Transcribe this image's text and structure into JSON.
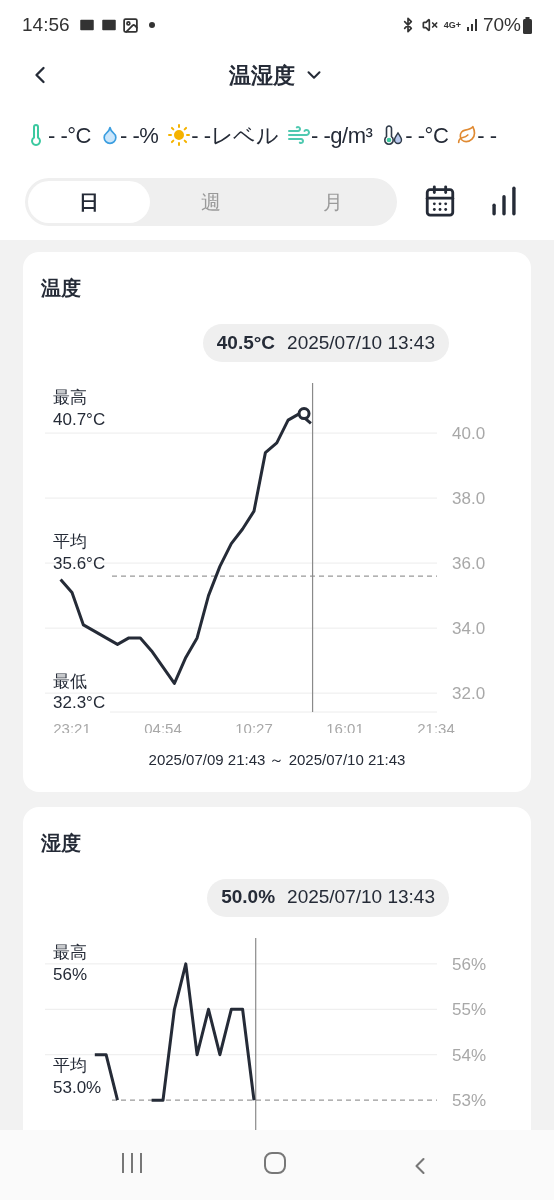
{
  "status_bar": {
    "time": "14:56",
    "network": "4G+",
    "battery": "70%"
  },
  "header": {
    "title": "温湿度"
  },
  "readings": [
    {
      "kind": "temperature",
      "value": "- -°C"
    },
    {
      "kind": "humidity",
      "value": "- -%"
    },
    {
      "kind": "light",
      "value": "- -レベル"
    },
    {
      "kind": "absolute_humidity",
      "value": "- -g/m³"
    },
    {
      "kind": "dew_point",
      "value": "- -°C"
    },
    {
      "kind": "leaf",
      "value": "- -"
    }
  ],
  "period_tabs": [
    {
      "label": "日",
      "selected": true
    },
    {
      "label": "週",
      "selected": false
    },
    {
      "label": "月",
      "selected": false
    }
  ],
  "cards": [
    {
      "title": "温度",
      "tooltip": {
        "value": "40.5°C",
        "time": "2025/07/10 13:43"
      },
      "stats": [
        {
          "kind": "max",
          "label": "最高",
          "value": "40.7°C"
        },
        {
          "kind": "avg",
          "label": "平均",
          "value": "35.6°C"
        },
        {
          "kind": "min",
          "label": "最低",
          "value": "32.3°C"
        }
      ],
      "range": "2025/07/09 21:43 ～ 2025/07/10 21:43",
      "chart_data": {
        "type": "line",
        "grid": true,
        "ylim": [
          31.42,
          41.54
        ],
        "categories": [
          null,
          null,
          "23:21",
          null,
          null,
          null,
          null,
          null,
          null,
          null,
          "04:54",
          null,
          null,
          null,
          null,
          null,
          null,
          null,
          "10:27",
          null,
          null,
          null,
          null,
          null,
          null,
          null,
          "16:01",
          null,
          null,
          null,
          null,
          null,
          null,
          null,
          "21:34"
        ],
        "yticks": [
          {
            "value": 32,
            "label": "32.0"
          },
          {
            "value": 34,
            "label": "34.0"
          },
          {
            "value": 36,
            "label": "36.0"
          },
          {
            "value": 38,
            "label": "38.0"
          },
          {
            "value": 40,
            "label": "40.0"
          }
        ],
        "series": [
          {
            "color": "#252b37",
            "values": [
              null,
              35.5,
              35.1,
              34.1,
              33.9,
              33.7,
              33.5,
              33.7,
              33.7,
              33.3,
              32.8,
              32.3,
              33.1,
              33.7,
              35.0,
              35.9,
              36.6,
              37.05,
              37.6,
              39.4,
              39.7,
              40.4,
              40.6,
              40.3,
              null,
              null,
              null,
              null,
              null,
              null,
              null,
              null,
              null,
              null,
              null
            ]
          }
        ],
        "ref_lines": [
          {
            "axis": "y",
            "value": 35.6
          }
        ]
      }
    },
    {
      "title": "湿度",
      "tooltip": {
        "value": "50.0%",
        "time": "2025/07/10 13:43"
      },
      "stats": [
        {
          "kind": "max",
          "label": "最高",
          "value": "56%"
        },
        {
          "kind": "avg",
          "label": "平均",
          "value": "53.0%"
        }
      ],
      "chart_data": {
        "type": "line",
        "grid": true,
        "ylim": [
          51,
          56.57
        ],
        "categories": [
          null,
          null,
          null,
          null,
          null,
          null,
          null,
          null,
          null,
          null,
          null,
          null,
          null,
          null,
          null,
          null,
          null,
          null,
          null,
          null,
          null,
          null,
          null,
          null,
          null,
          null,
          null,
          null,
          null,
          null,
          null,
          null,
          null,
          null,
          null
        ],
        "yticks": [
          {
            "value": 53,
            "label": "53%"
          },
          {
            "value": 54,
            "label": "54%"
          },
          {
            "value": 55,
            "label": "55%"
          },
          {
            "value": 56,
            "label": "56%"
          }
        ],
        "series": [
          {
            "color": "#252b37",
            "values": [
              null,
              null,
              null,
              null,
              54,
              54,
              53,
              null,
              null,
              53,
              53,
              55,
              56,
              54,
              55,
              54,
              55,
              55,
              53,
              null,
              null,
              null,
              null,
              null,
              null,
              null,
              null,
              null,
              null,
              null,
              null,
              null,
              null,
              null,
              null
            ]
          }
        ],
        "ref_lines": [
          {
            "axis": "y",
            "value": 53
          }
        ]
      }
    }
  ]
}
